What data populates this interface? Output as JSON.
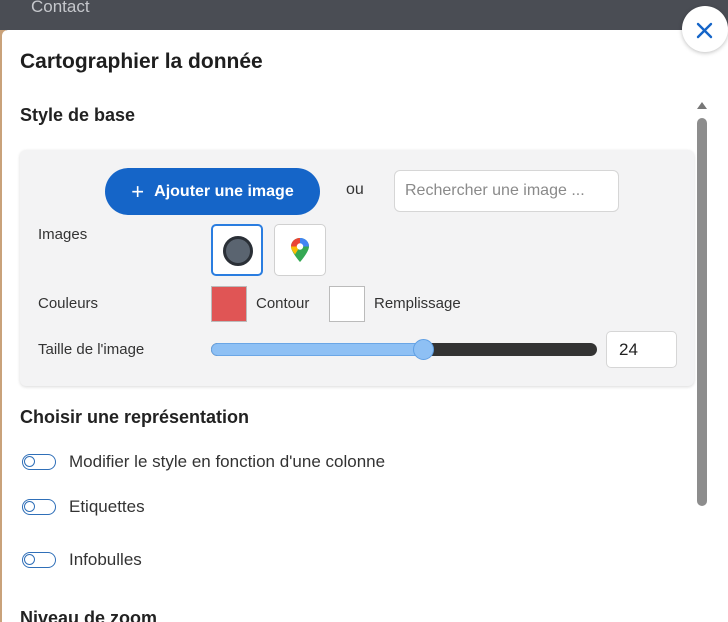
{
  "background": {
    "nav_item": "Contact"
  },
  "dialog": {
    "title": "Cartographier la donnée",
    "close_icon": "close-icon",
    "base_style": {
      "title": "Style de base",
      "add_image_label": "Ajouter une image",
      "or_label": "ou",
      "search_placeholder": "Rechercher une image ...",
      "images_label": "Images",
      "image_options": [
        {
          "icon": "circle-marker-icon",
          "selected": true
        },
        {
          "icon": "map-pin-icon",
          "selected": false
        }
      ],
      "colors_label": "Couleurs",
      "stroke_label": "Contour",
      "stroke_color": "#e05555",
      "fill_label": "Remplissage",
      "fill_color": "#ffffff",
      "size_label": "Taille de l'image",
      "size_value": "24",
      "size_slider_fraction": 0.55
    },
    "representation": {
      "title": "Choisir une représentation",
      "toggles": [
        {
          "label": "Modifier le style en fonction d'une colonne",
          "on": false
        },
        {
          "label": "Etiquettes",
          "on": false
        },
        {
          "label": "Infobulles",
          "on": false
        }
      ]
    },
    "zoom": {
      "title": "Niveau de zoom"
    }
  },
  "colors": {
    "accent": "#1565c8",
    "slider": "#8ec0f4"
  }
}
